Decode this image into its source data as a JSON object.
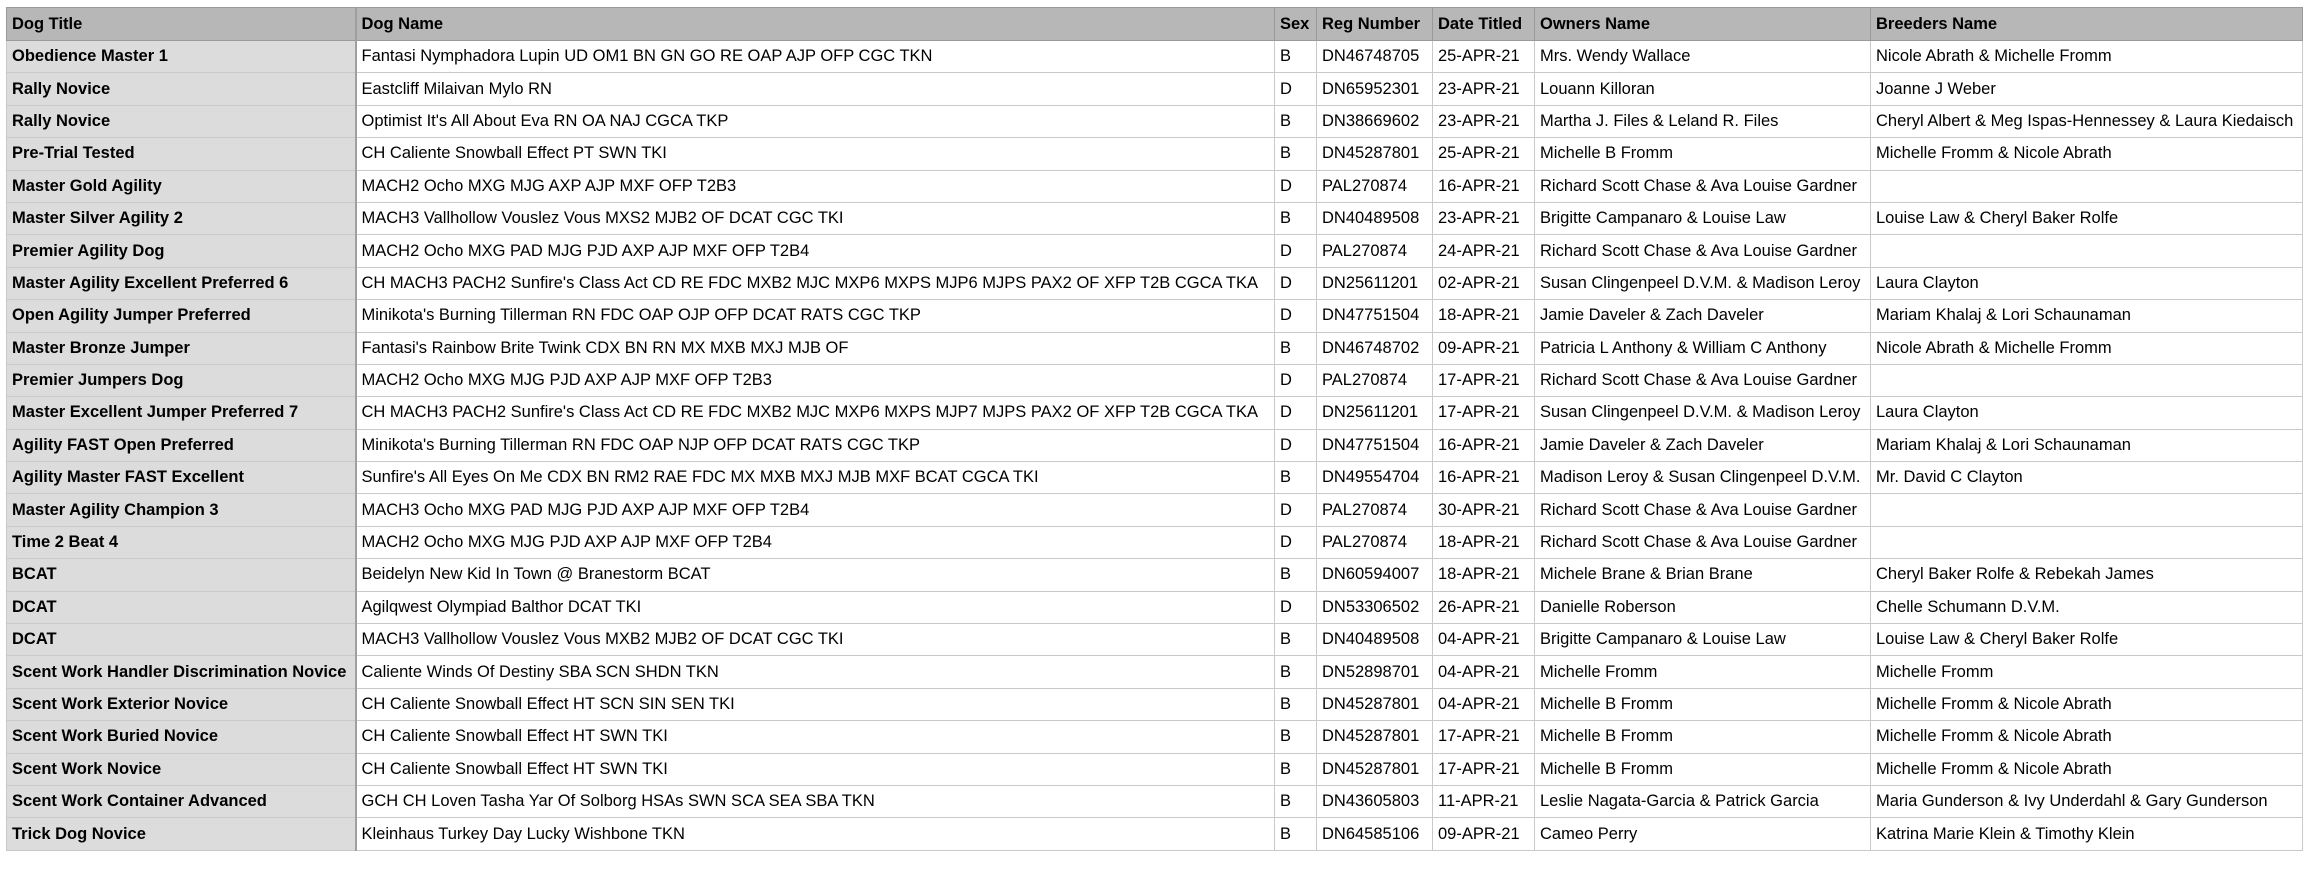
{
  "table": {
    "headers": [
      "Dog Title",
      "Dog Name",
      "Sex",
      "Reg Number",
      "Date Titled",
      "Owners Name",
      "Breeders Name"
    ],
    "rows": [
      [
        "Obedience Master 1",
        "Fantasi Nymphadora Lupin UD OM1 BN GN GO RE OAP AJP OFP CGC TKN",
        "B",
        "DN46748705",
        "25-APR-21",
        "Mrs. Wendy Wallace",
        "Nicole Abrath & Michelle Fromm"
      ],
      [
        "Rally Novice",
        "Eastcliff Milaivan Mylo RN",
        "D",
        "DN65952301",
        "23-APR-21",
        "Louann Killoran",
        "Joanne J Weber"
      ],
      [
        "Rally Novice",
        "Optimist It's All About Eva RN OA NAJ CGCA TKP",
        "B",
        "DN38669602",
        "23-APR-21",
        "Martha J. Files & Leland R. Files",
        "Cheryl Albert & Meg Ispas-Hennessey & Laura Kiedaisch"
      ],
      [
        "Pre-Trial Tested",
        "CH Caliente Snowball Effect PT SWN TKI",
        "B",
        "DN45287801",
        "25-APR-21",
        "Michelle B Fromm",
        "Michelle Fromm & Nicole Abrath"
      ],
      [
        "Master Gold Agility",
        "MACH2 Ocho MXG MJG AXP AJP MXF OFP T2B3",
        "D",
        "PAL270874",
        "16-APR-21",
        "Richard Scott Chase & Ava Louise Gardner",
        ""
      ],
      [
        "Master Silver Agility 2",
        "MACH3 Vallhollow Vouslez Vous MXS2 MJB2 OF DCAT CGC TKI",
        "B",
        "DN40489508",
        "23-APR-21",
        "Brigitte Campanaro & Louise Law",
        "Louise Law & Cheryl Baker Rolfe"
      ],
      [
        "Premier Agility Dog",
        "MACH2 Ocho MXG PAD MJG PJD AXP AJP MXF OFP T2B4",
        "D",
        "PAL270874",
        "24-APR-21",
        "Richard Scott Chase & Ava Louise Gardner",
        ""
      ],
      [
        "Master Agility Excellent Preferred 6",
        "CH MACH3 PACH2 Sunfire's Class Act CD RE FDC MXB2 MJC MXP6 MXPS MJP6 MJPS PAX2 OF XFP T2B CGCA TKA",
        "D",
        "DN25611201",
        "02-APR-21",
        "Susan Clingenpeel D.V.M. & Madison Leroy",
        "Laura Clayton"
      ],
      [
        "Open Agility Jumper Preferred",
        "Minikota's Burning Tillerman RN FDC OAP OJP OFP DCAT RATS CGC TKP",
        "D",
        "DN47751504",
        "18-APR-21",
        "Jamie Daveler & Zach Daveler",
        "Mariam Khalaj & Lori Schaunaman"
      ],
      [
        "Master Bronze Jumper",
        "Fantasi's Rainbow Brite Twink CDX BN RN MX MXB MXJ MJB OF",
        "B",
        "DN46748702",
        "09-APR-21",
        "Patricia L Anthony & William C Anthony",
        "Nicole Abrath & Michelle Fromm"
      ],
      [
        "Premier Jumpers Dog",
        "MACH2 Ocho MXG MJG PJD AXP AJP MXF OFP T2B3",
        "D",
        "PAL270874",
        "17-APR-21",
        "Richard Scott Chase & Ava Louise Gardner",
        ""
      ],
      [
        "Master Excellent Jumper Preferred 7",
        "CH MACH3 PACH2 Sunfire's Class Act CD RE FDC MXB2 MJC MXP6 MXPS MJP7 MJPS PAX2 OF XFP T2B CGCA TKA",
        "D",
        "DN25611201",
        "17-APR-21",
        "Susan Clingenpeel D.V.M. & Madison Leroy",
        "Laura Clayton"
      ],
      [
        "Agility FAST Open Preferred",
        "Minikota's Burning Tillerman RN FDC OAP NJP OFP DCAT RATS CGC TKP",
        "D",
        "DN47751504",
        "16-APR-21",
        "Jamie Daveler & Zach Daveler",
        "Mariam Khalaj & Lori Schaunaman"
      ],
      [
        "Agility Master FAST Excellent",
        "Sunfire's All Eyes On Me CDX BN RM2 RAE FDC MX MXB MXJ MJB MXF BCAT CGCA TKI",
        "B",
        "DN49554704",
        "16-APR-21",
        "Madison Leroy & Susan Clingenpeel D.V.M.",
        "Mr. David C Clayton"
      ],
      [
        "Master Agility Champion 3",
        "MACH3 Ocho MXG PAD MJG PJD AXP AJP MXF OFP T2B4",
        "D",
        "PAL270874",
        "30-APR-21",
        "Richard Scott Chase & Ava Louise Gardner",
        ""
      ],
      [
        "Time 2 Beat 4",
        "MACH2 Ocho MXG MJG PJD AXP AJP MXF OFP T2B4",
        "D",
        "PAL270874",
        "18-APR-21",
        "Richard Scott Chase & Ava Louise Gardner",
        ""
      ],
      [
        "BCAT",
        "Beidelyn New Kid In Town @ Branestorm BCAT",
        "B",
        "DN60594007",
        "18-APR-21",
        "Michele Brane & Brian Brane",
        "Cheryl Baker Rolfe & Rebekah James"
      ],
      [
        "DCAT",
        "Agilqwest Olympiad Balthor DCAT TKI",
        "D",
        "DN53306502",
        "26-APR-21",
        "Danielle Roberson",
        "Chelle Schumann D.V.M."
      ],
      [
        "DCAT",
        "MACH3 Vallhollow Vouslez Vous MXB2 MJB2 OF DCAT CGC TKI",
        "B",
        "DN40489508",
        "04-APR-21",
        "Brigitte Campanaro & Louise Law",
        "Louise Law & Cheryl Baker Rolfe"
      ],
      [
        "Scent Work Handler Discrimination Novice",
        "Caliente Winds Of Destiny SBA SCN SHDN TKN",
        "B",
        "DN52898701",
        "04-APR-21",
        "Michelle Fromm",
        "Michelle Fromm"
      ],
      [
        "Scent Work Exterior Novice",
        "CH Caliente Snowball Effect HT SCN SIN SEN TKI",
        "B",
        "DN45287801",
        "04-APR-21",
        "Michelle B Fromm",
        "Michelle Fromm & Nicole Abrath"
      ],
      [
        "Scent Work Buried Novice",
        "CH Caliente Snowball Effect HT SWN TKI",
        "B",
        "DN45287801",
        "17-APR-21",
        "Michelle B Fromm",
        "Michelle Fromm & Nicole Abrath"
      ],
      [
        "Scent Work Novice",
        "CH Caliente Snowball Effect HT SWN TKI",
        "B",
        "DN45287801",
        "17-APR-21",
        "Michelle B Fromm",
        "Michelle Fromm & Nicole Abrath"
      ],
      [
        "Scent Work Container Advanced",
        "GCH CH Loven Tasha Yar Of Solborg HSAs SWN SCA SEA SBA TKN",
        "B",
        "DN43605803",
        "11-APR-21",
        "Leslie Nagata-Garcia & Patrick Garcia",
        "Maria Gunderson & Ivy Underdahl & Gary Gunderson"
      ],
      [
        "Trick Dog Novice",
        "Kleinhaus Turkey Day Lucky Wishbone TKN",
        "B",
        "DN64585106",
        "09-APR-21",
        "Cameo Perry",
        "Katrina Marie Klein & Timothy Klein"
      ]
    ]
  }
}
